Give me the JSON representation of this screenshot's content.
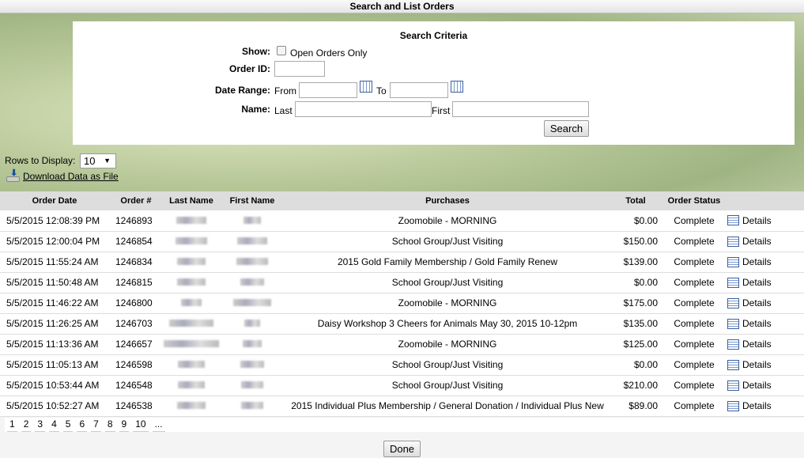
{
  "title": "Search and List Orders",
  "search": {
    "heading": "Search Criteria",
    "show_label": "Show:",
    "open_only": "Open Orders Only",
    "order_id_label": "Order ID:",
    "date_range_label": "Date Range:",
    "from": "From",
    "to": "To",
    "name_label": "Name:",
    "last": "Last",
    "first": "First",
    "search_button": "Search"
  },
  "rows_label": "Rows to Display:",
  "rows_value": "10",
  "download": "Download Data as File",
  "columns": [
    "Order Date",
    "Order #",
    "Last Name",
    "First Name",
    "Purchases",
    "Total",
    "Order Status",
    ""
  ],
  "orders": [
    {
      "date": "5/5/2015 12:08:39 PM",
      "id": "1246893",
      "purchase": "Zoomobile - MORNING",
      "total": "$0.00",
      "status": "Complete",
      "details": "Details"
    },
    {
      "date": "5/5/2015 12:00:04 PM",
      "id": "1246854",
      "purchase": "School Group/Just Visiting",
      "total": "$150.00",
      "status": "Complete",
      "details": "Details"
    },
    {
      "date": "5/5/2015 11:55:24 AM",
      "id": "1246834",
      "purchase": "2015 Gold Family Membership / Gold Family Renew",
      "total": "$139.00",
      "status": "Complete",
      "details": "Details"
    },
    {
      "date": "5/5/2015 11:50:48 AM",
      "id": "1246815",
      "purchase": "School Group/Just Visiting",
      "total": "$0.00",
      "status": "Complete",
      "details": "Details"
    },
    {
      "date": "5/5/2015 11:46:22 AM",
      "id": "1246800",
      "purchase": "Zoomobile - MORNING",
      "total": "$175.00",
      "status": "Complete",
      "details": "Details"
    },
    {
      "date": "5/5/2015 11:26:25 AM",
      "id": "1246703",
      "purchase": "Daisy Workshop 3 Cheers for Animals May 30, 2015 10-12pm",
      "total": "$135.00",
      "status": "Complete",
      "details": "Details"
    },
    {
      "date": "5/5/2015 11:13:36 AM",
      "id": "1246657",
      "purchase": "Zoomobile - MORNING",
      "total": "$125.00",
      "status": "Complete",
      "details": "Details"
    },
    {
      "date": "5/5/2015 11:05:13 AM",
      "id": "1246598",
      "purchase": "School Group/Just Visiting",
      "total": "$0.00",
      "status": "Complete",
      "details": "Details"
    },
    {
      "date": "5/5/2015 10:53:44 AM",
      "id": "1246548",
      "purchase": "School Group/Just Visiting",
      "total": "$210.00",
      "status": "Complete",
      "details": "Details"
    },
    {
      "date": "5/5/2015 10:52:27 AM",
      "id": "1246538",
      "purchase": "2015 Individual Plus Membership / General Donation / Individual Plus New",
      "total": "$89.00",
      "status": "Complete",
      "details": "Details"
    }
  ],
  "pages": [
    "1",
    "2",
    "3",
    "4",
    "5",
    "6",
    "7",
    "8",
    "9",
    "10",
    "..."
  ],
  "done_button": "Done"
}
